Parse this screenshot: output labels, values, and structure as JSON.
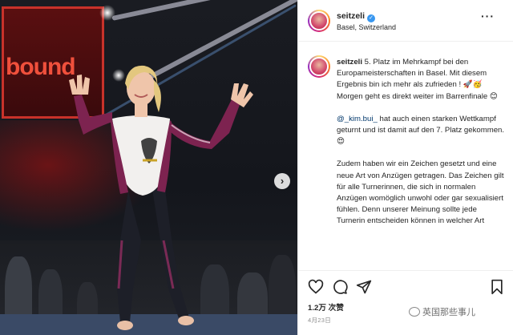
{
  "photo": {
    "screen_text": "bound",
    "next_arrow": "›"
  },
  "header": {
    "username": "seitzeli",
    "verified_glyph": "✓",
    "location": "Basel, Switzerland",
    "more": "···"
  },
  "caption": {
    "username": "seitzeli",
    "paragraph_1": "5. Platz im Mehrkampf bei den Europameisterschaften in Basel. Mit diesem Ergebnis bin ich mehr als zufrieden ! 🚀🥳",
    "paragraph_1b": "Morgen geht es direkt weiter im Barrenfinale 😊",
    "mention": "@_kim.bui_",
    "paragraph_2": " hat auch einen starken Wettkampf geturnt und ist damit auf den 7. Platz gekommen. 😍",
    "paragraph_3": "Zudem haben wir ein Zeichen gesetzt und eine neue Art von Anzügen getragen. Das Zeichen gilt für alle Turnerinnen, die sich in normalen Anzügen womöglich unwohl oder gar sexualisiert fühlen. Denn unserer Meinung sollte jede Turnerin entscheiden können in welcher Art"
  },
  "actions": {
    "like_icon": "heart-icon",
    "comment_icon": "comment-icon",
    "share_icon": "share-icon",
    "save_icon": "bookmark-icon",
    "likes": "1.2万 次赞",
    "date": "4月23日"
  },
  "watermark": "英国那些事儿",
  "colors": {
    "accent_blue": "#3897f0",
    "mention": "#00376b",
    "screen_red": "#c8322a"
  }
}
